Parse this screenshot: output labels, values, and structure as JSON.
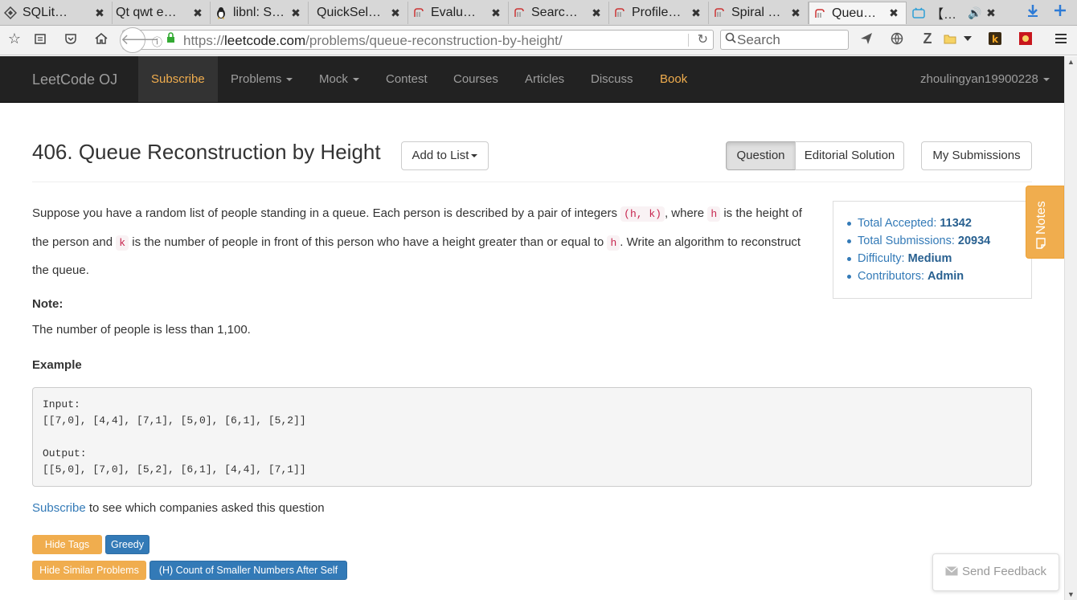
{
  "browser": {
    "tabs": [
      {
        "title": "SQLit…",
        "icon": "sqlite-icon"
      },
      {
        "title": "Qt qwt e…",
        "icon": "none"
      },
      {
        "title": "libnl: S…",
        "icon": "linux-penguin-icon"
      },
      {
        "title": "QuickSel…",
        "icon": "none"
      },
      {
        "title": "Evalu…",
        "icon": "leetcode-icon"
      },
      {
        "title": "Searc…",
        "icon": "leetcode-icon"
      },
      {
        "title": "Profile…",
        "icon": "leetcode-icon"
      },
      {
        "title": "Spiral …",
        "icon": "leetcode-icon"
      },
      {
        "title": "Queu…",
        "icon": "leetcode-icon"
      },
      {
        "title": "【…",
        "icon": "bilibili-icon"
      }
    ],
    "url_prefix": "https://",
    "url_host": "leetcode.com",
    "url_path": "/problems/queue-reconstruction-by-height/",
    "search_placeholder": "Search"
  },
  "site": {
    "brand": "LeetCode OJ",
    "nav": {
      "subscribe": "Subscribe",
      "problems": "Problems",
      "mock": "Mock",
      "contest": "Contest",
      "courses": "Courses",
      "articles": "Articles",
      "discuss": "Discuss",
      "book": "Book",
      "user": "zhoulingyan19900228"
    }
  },
  "problem": {
    "title": "406. Queue Reconstruction by Height",
    "add_to_list": "Add to List",
    "tabs": {
      "question": "Question",
      "editorial": "Editorial Solution"
    },
    "my_submissions": "My Submissions",
    "desc": {
      "p1": "Suppose you have a random list of people standing in a queue. Each person is described by a pair of integers",
      "code_hk": "(h, k)",
      "p2": ", where",
      "code_h": "h",
      "p3": "is the height of the person and",
      "code_k": "k",
      "p4": "is the number of people in front of this person who have a height greater than or equal to",
      "code_h2": "h",
      "p5": ". Write an algorithm to reconstruct the queue."
    },
    "note_heading": "Note:",
    "note_text": "The number of people is less than 1,100.",
    "example_heading": "Example",
    "example_lines": [
      "Input:",
      "[[7,0], [4,4], [7,1], [5,0], [6,1], [5,2]]",
      "",
      "Output:",
      "[[5,0], [7,0], [5,2], [6,1], [4,4], [7,1]]"
    ],
    "subscribe_link": "Subscribe",
    "subscribe_rest": "to see which companies asked this question",
    "hide_tags": "Hide Tags",
    "tag_greedy": "Greedy",
    "hide_similar": "Hide Similar Problems",
    "similar_1": "(H) Count of Smaller Numbers After Self"
  },
  "stats": {
    "accepted_label": "Total Accepted:",
    "accepted_value": "11342",
    "submissions_label": "Total Submissions:",
    "submissions_value": "20934",
    "difficulty_label": "Difficulty:",
    "difficulty_value": "Medium",
    "contributors_label": "Contributors:",
    "contributors_value": "Admin"
  },
  "notes_label": "Notes",
  "feedback_label": "Send Feedback",
  "colors": {
    "accent_orange": "#f0ad4e",
    "link_blue": "#337ab7",
    "header_dark": "#222222"
  }
}
